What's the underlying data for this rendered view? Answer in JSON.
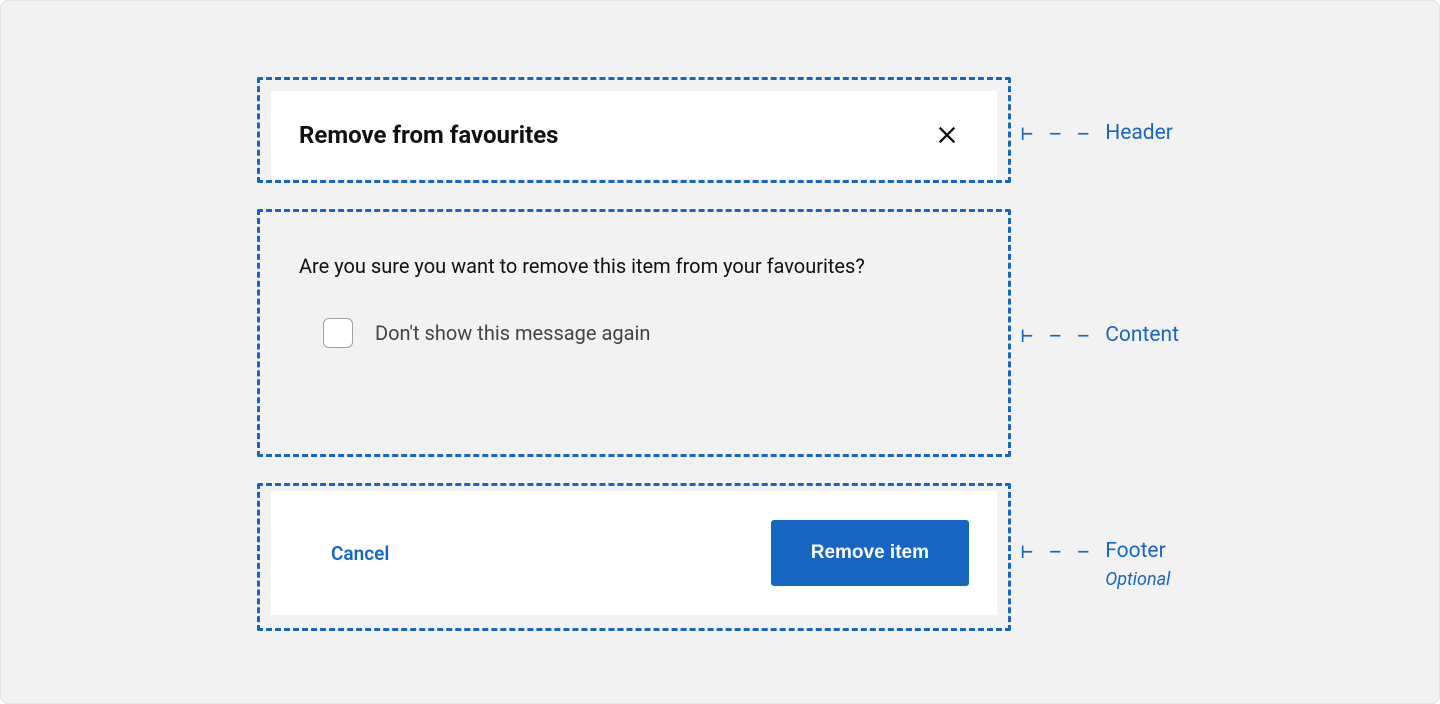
{
  "dialog": {
    "title": "Remove from favourites",
    "message": "Are you sure you want to remove this item from your favourites?",
    "checkbox_label": "Don't show this message again",
    "cancel_label": "Cancel",
    "confirm_label": "Remove item"
  },
  "annotations": {
    "header": "Header",
    "content": "Content",
    "footer": "Footer",
    "footer_sub": "Optional",
    "tick": "⊢ − −"
  },
  "colors": {
    "accent": "#1766c2",
    "page_bg": "#f2f2f2"
  }
}
